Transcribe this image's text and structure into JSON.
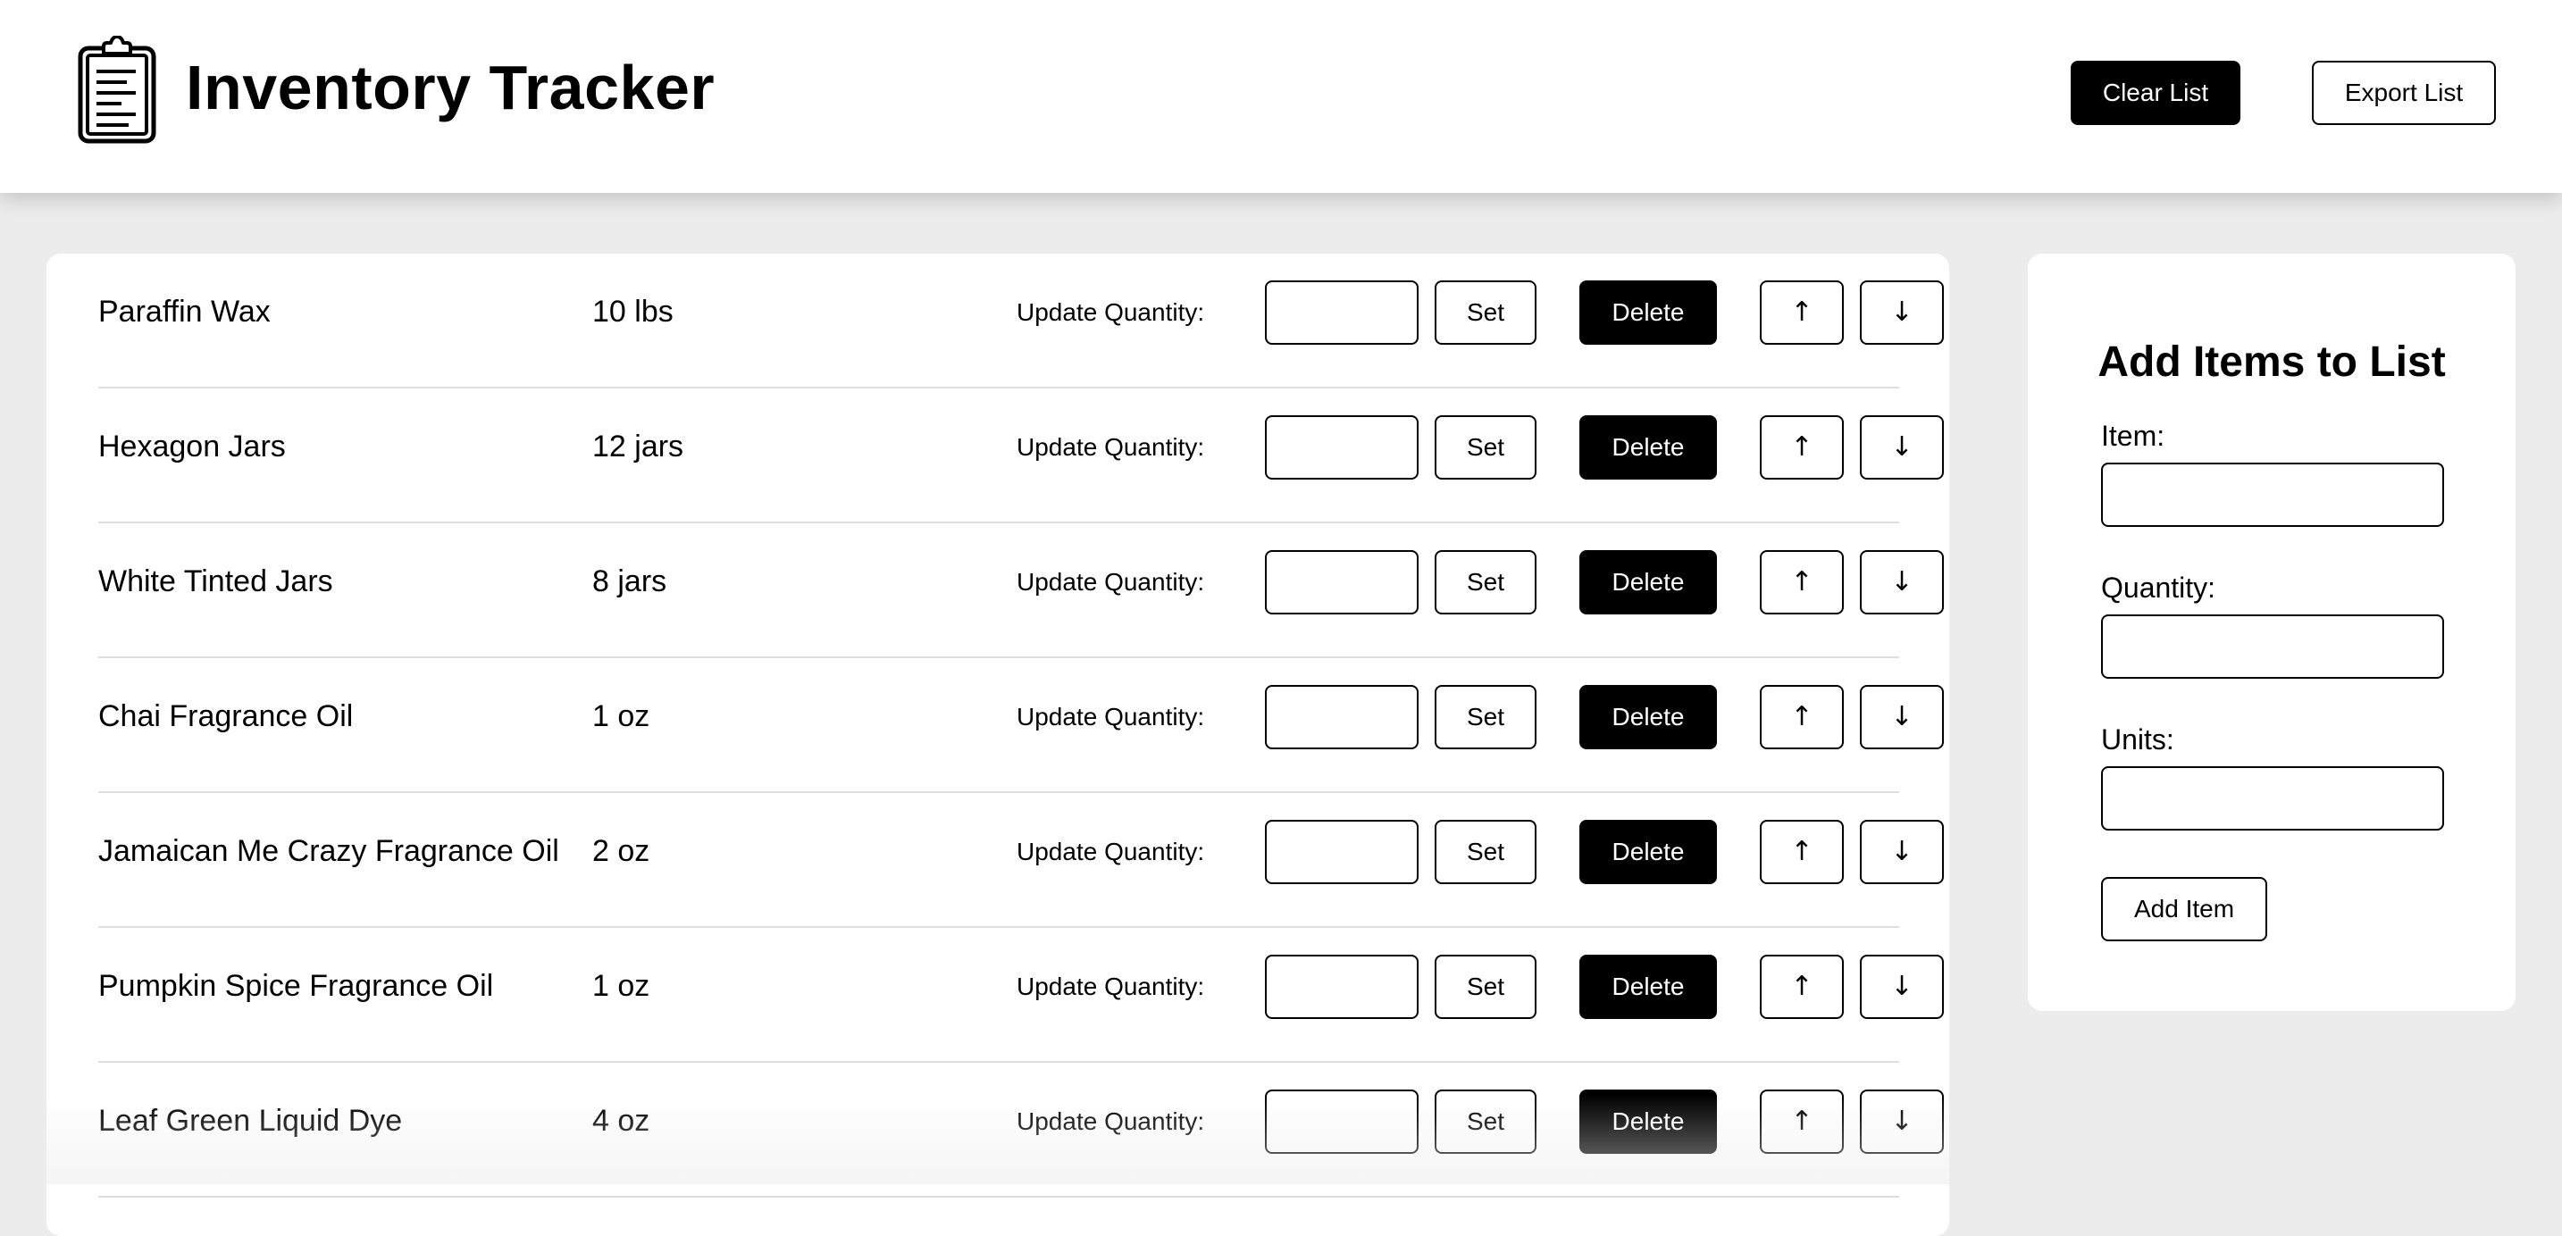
{
  "header": {
    "title": "Inventory Tracker",
    "logo_icon": "clipboard-icon",
    "clear_label": "Clear List",
    "export_label": "Export List"
  },
  "list": {
    "update_label": "Update Quantity:",
    "set_label": "Set",
    "delete_label": "Delete",
    "up_icon": "arrow-up-icon",
    "down_icon": "arrow-down-icon",
    "up_glyph": "↑",
    "down_glyph": "↓",
    "items": [
      {
        "name": "Paraffin Wax",
        "quantity": "10 lbs",
        "input_value": ""
      },
      {
        "name": "Hexagon Jars",
        "quantity": "12 jars",
        "input_value": ""
      },
      {
        "name": "White Tinted Jars",
        "quantity": "8 jars",
        "input_value": ""
      },
      {
        "name": "Chai Fragrance Oil",
        "quantity": "1 oz",
        "input_value": ""
      },
      {
        "name": "Jamaican Me Crazy Fragrance Oil",
        "quantity": "2 oz",
        "input_value": ""
      },
      {
        "name": "Pumpkin Spice Fragrance Oil",
        "quantity": "1 oz",
        "input_value": ""
      },
      {
        "name": "Leaf Green Liquid Dye",
        "quantity": "4 oz",
        "input_value": ""
      }
    ]
  },
  "add_panel": {
    "title": "Add Items to List",
    "item_label": "Item:",
    "item_value": "",
    "quantity_label": "Quantity:",
    "quantity_value": "",
    "units_label": "Units:",
    "units_value": "",
    "add_label": "Add Item"
  },
  "colors": {
    "background": "#ececec",
    "card": "#ffffff",
    "primary": "#000000",
    "divider": "#dedede"
  }
}
